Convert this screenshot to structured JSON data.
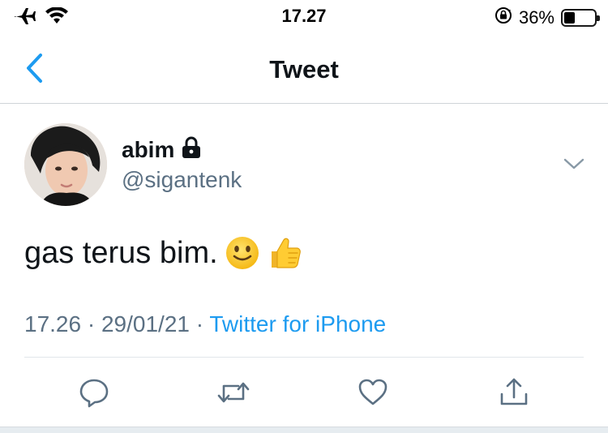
{
  "status_bar": {
    "time": "17.27",
    "battery_percent_text": "36%",
    "battery_level": 0.36,
    "icons": [
      "airplane-icon",
      "wifi-icon",
      "orientation-lock-icon",
      "battery-icon"
    ]
  },
  "nav": {
    "title": "Tweet",
    "back_icon": "chevron-left-icon"
  },
  "tweet": {
    "display_name": "abim",
    "protected_icon": "lock-icon",
    "handle": "@sigantenk",
    "text": "gas terus bim.",
    "emojis": [
      "slightly-smiling-face",
      "thumbs-up"
    ],
    "time": "17.26",
    "date": "29/01/21",
    "separator": "·",
    "source": "Twitter for iPhone"
  },
  "actions": [
    "reply-icon",
    "retweet-icon",
    "like-icon",
    "share-icon"
  ],
  "colors": {
    "accent": "#1d9bf0",
    "secondary_text": "#5b7083",
    "primary_text": "#0f1419"
  }
}
